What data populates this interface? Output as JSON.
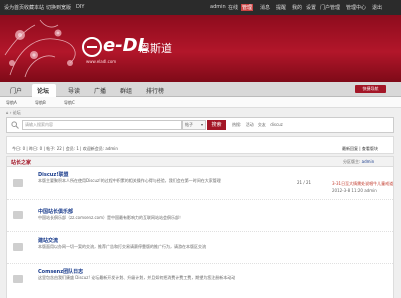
{
  "topbar": {
    "left_links": [
      "设为首页",
      "收藏本站",
      "切换到宽版",
      "DIY"
    ],
    "user": "admin",
    "online": "在线",
    "badge": "管理",
    "right_links": [
      "消息",
      "提醒",
      "我的",
      "设置",
      "门户管理",
      "管理中心",
      "退出"
    ]
  },
  "banner": {
    "logo_text": "e-DL",
    "logo_cn": "恩斯道",
    "logo_url": "www.eladl.com"
  },
  "nav": {
    "items": [
      "门户",
      "论坛",
      "导读",
      "广播",
      "群组",
      "排行榜"
    ],
    "quick_nav": "快捷导航"
  },
  "subnav": {
    "items": [
      "导航A",
      "导航B",
      "导航C"
    ]
  },
  "breadcrumb": "论坛",
  "search": {
    "placeholder": "请输入搜索内容",
    "type": "帖子",
    "button": "搜索",
    "hot_label": "热搜:",
    "hot_items": [
      "活动",
      "交友",
      "discuz"
    ]
  },
  "stats": {
    "text": "今日: 0  |  昨日: 0  |  帖子: 22  |  会员: 1  |  欢迎新会员: admin",
    "link1": "最新回复",
    "link2": "查看版块"
  },
  "section": {
    "title": "站长之家",
    "moderator_label": "分区版主:",
    "moderator": "admin"
  },
  "forums": [
    {
      "title": "Discuz!联盟",
      "desc": "本版主要聚积本人所在使用Discuz!的过程中积累的相关操作心得与经验，我们会在第一时间在大家管理",
      "count": "21 / 21",
      "last_title": "3-31日至大情需处说唱牛儿童戒道",
      "last_meta": "2012-3-8 11:20 admin"
    },
    {
      "title": "中国站长俱乐部",
      "desc": "中国站长俱乐部（zz.comsenz.com）是中国最有影响力的互联网站站会俱乐部！",
      "count": "",
      "last_title": "",
      "last_meta": ""
    },
    {
      "title": "建站交流",
      "desc": "本版面用以办网一切一案的交流，推荐广告和打交易请赛停靠版的推广行为，请游在本版区交流",
      "count": "",
      "last_title": "",
      "last_meta": ""
    },
    {
      "title": "Comsenz团队日志",
      "desc": "这里包含由我们康盛 Discuz! 论坛最新开发计划、升级计划，并且如何把消费计费工费，期望为您注册新本动动",
      "count": "",
      "last_title": "",
      "last_meta": ""
    }
  ],
  "colors": {
    "accent": "#a31627",
    "link": "#1a3c8c"
  }
}
